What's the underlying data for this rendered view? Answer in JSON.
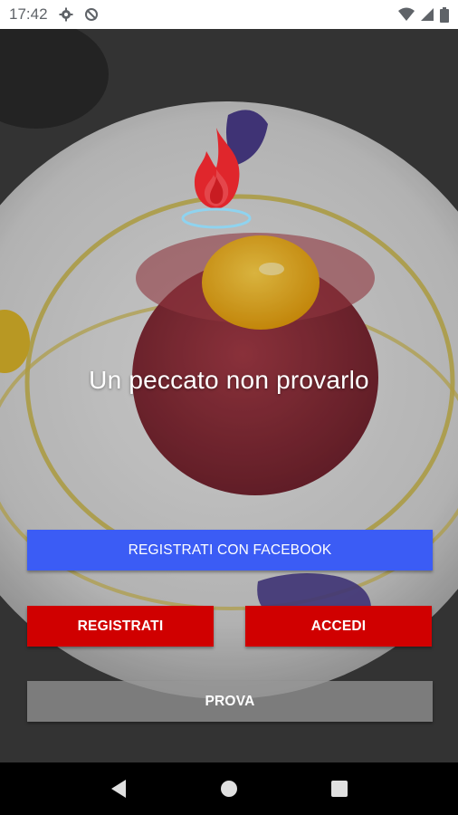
{
  "status_bar": {
    "time": "17:42",
    "icons": [
      "gear-icon",
      "sync-disabled-icon",
      "wifi-icon",
      "signal-icon",
      "battery-icon"
    ]
  },
  "hero": {
    "tagline": "Un peccato non provarlo"
  },
  "buttons": {
    "facebook_label": "REGISTRATI CON FACEBOOK",
    "register_label": "REGISTRATI",
    "login_label": "ACCEDI",
    "try_label": "PROVA"
  },
  "colors": {
    "facebook": "#3b5cf5",
    "primary_red": "#d00000",
    "try_gray": "#969696",
    "logo_ring": "#8fd3ef"
  },
  "nav_bar": {
    "icons": [
      "back-icon",
      "home-icon",
      "recents-icon"
    ]
  }
}
